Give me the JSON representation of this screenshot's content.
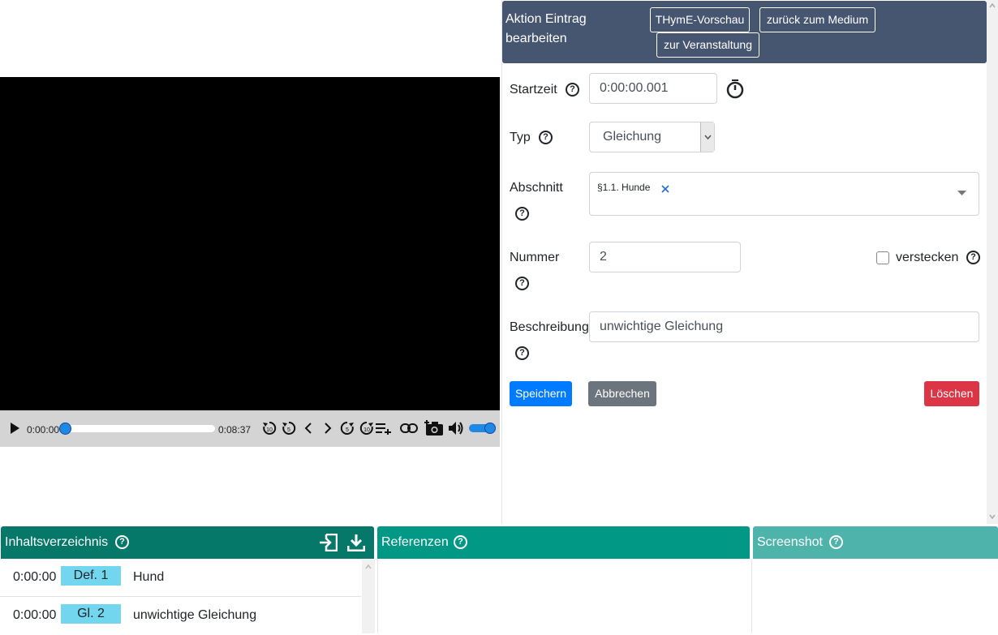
{
  "video": {
    "current_time": "0:00:00",
    "duration": "0:08:37",
    "progress_fraction": 0.0,
    "volume_fraction": 1.0
  },
  "edit": {
    "title": "Aktion Eintrag bearbeiten",
    "buttons": {
      "preview": "THymE-Vorschau",
      "back_medium": "zurück zum Medium",
      "to_event": "zur Veranstaltung"
    },
    "fields": {
      "start_label": "Startzeit",
      "start_value": "0:00:00.001",
      "type_label": "Typ",
      "type_value": "Gleichung",
      "section_label": "Abschnitt",
      "section_tag": "§1.1. Hunde",
      "number_label": "Nummer",
      "number_value": "2",
      "hide_label": "verstecken",
      "description_label": "Beschreibung",
      "description_value": "unwichtige Gleichung"
    },
    "actions": {
      "save": "Speichern",
      "cancel": "Abbrechen",
      "delete": "Löschen"
    }
  },
  "panels": {
    "toc_title": "Inhaltsverzeichnis",
    "references_title": "Referenzen",
    "screenshot_title": "Screenshot",
    "toc_items": [
      {
        "time": "0:00:00",
        "badge": "Def. 1",
        "text": "Hund"
      },
      {
        "time": "0:00:00",
        "badge": "Gl. 2",
        "text": "unwichtige Gleichung"
      }
    ]
  },
  "colors": {
    "header_bg": "#465670",
    "toc_header": "#05786a",
    "references_header": "#019985",
    "screenshot_header": "#4db3ab",
    "save_btn": "#007bff",
    "cancel_btn": "#6c757d",
    "delete_btn": "#dc3545",
    "badge": "#71d6ee"
  }
}
